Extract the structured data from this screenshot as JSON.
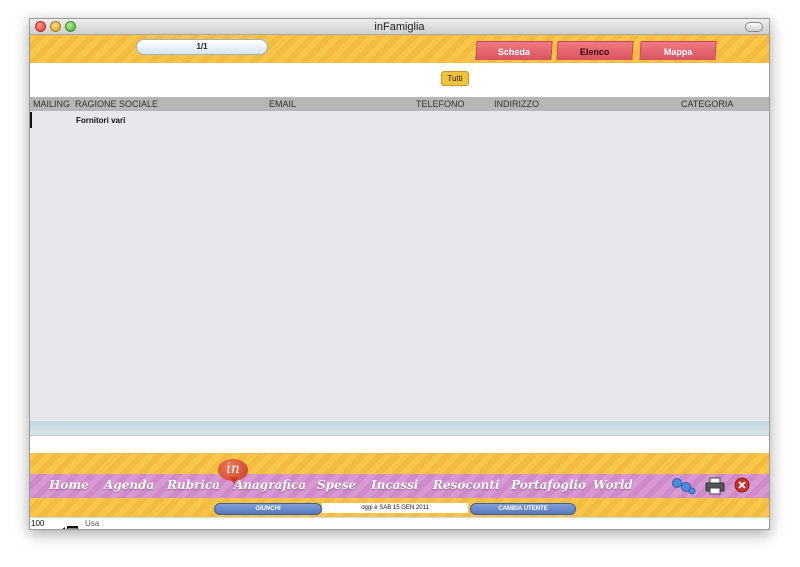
{
  "window": {
    "title": "inFamiglia"
  },
  "toolbar": {
    "record_counter": "1/1",
    "tabs": [
      "Scheda",
      "Elenco",
      "Mappa"
    ],
    "active_tab": "Elenco"
  },
  "filter": {
    "label": "Tutti"
  },
  "columns": [
    "MAILING",
    "RAGIONE SOCIALE",
    "EMAIL",
    "TELEFONO",
    "INDIRIZZO",
    "CATEGORIA"
  ],
  "rows": [
    {
      "ragione_sociale": "Fornitori vari"
    }
  ],
  "nav": {
    "badge": "in",
    "items": [
      "Home",
      "Agenda",
      "Rubrica",
      "Anagrafica",
      "Spese",
      "Incassi",
      "Resoconti",
      "Portafoglio",
      "World"
    ]
  },
  "status": {
    "user_button": "GIUNCHI",
    "date_text": "oggi è   SAB 15 GEN 2011",
    "change_user_button": "CAMBIA UTENTE"
  },
  "bottom": {
    "zoom": "100",
    "mode": "Usa"
  },
  "colors": {
    "accent_yellow": "#f8c64b",
    "tab_red": "#d9535f",
    "nav_purple": "#d899d3",
    "list_bg": "#e6e8ec"
  },
  "icons": [
    "users-icon",
    "print-icon",
    "close-icon"
  ]
}
